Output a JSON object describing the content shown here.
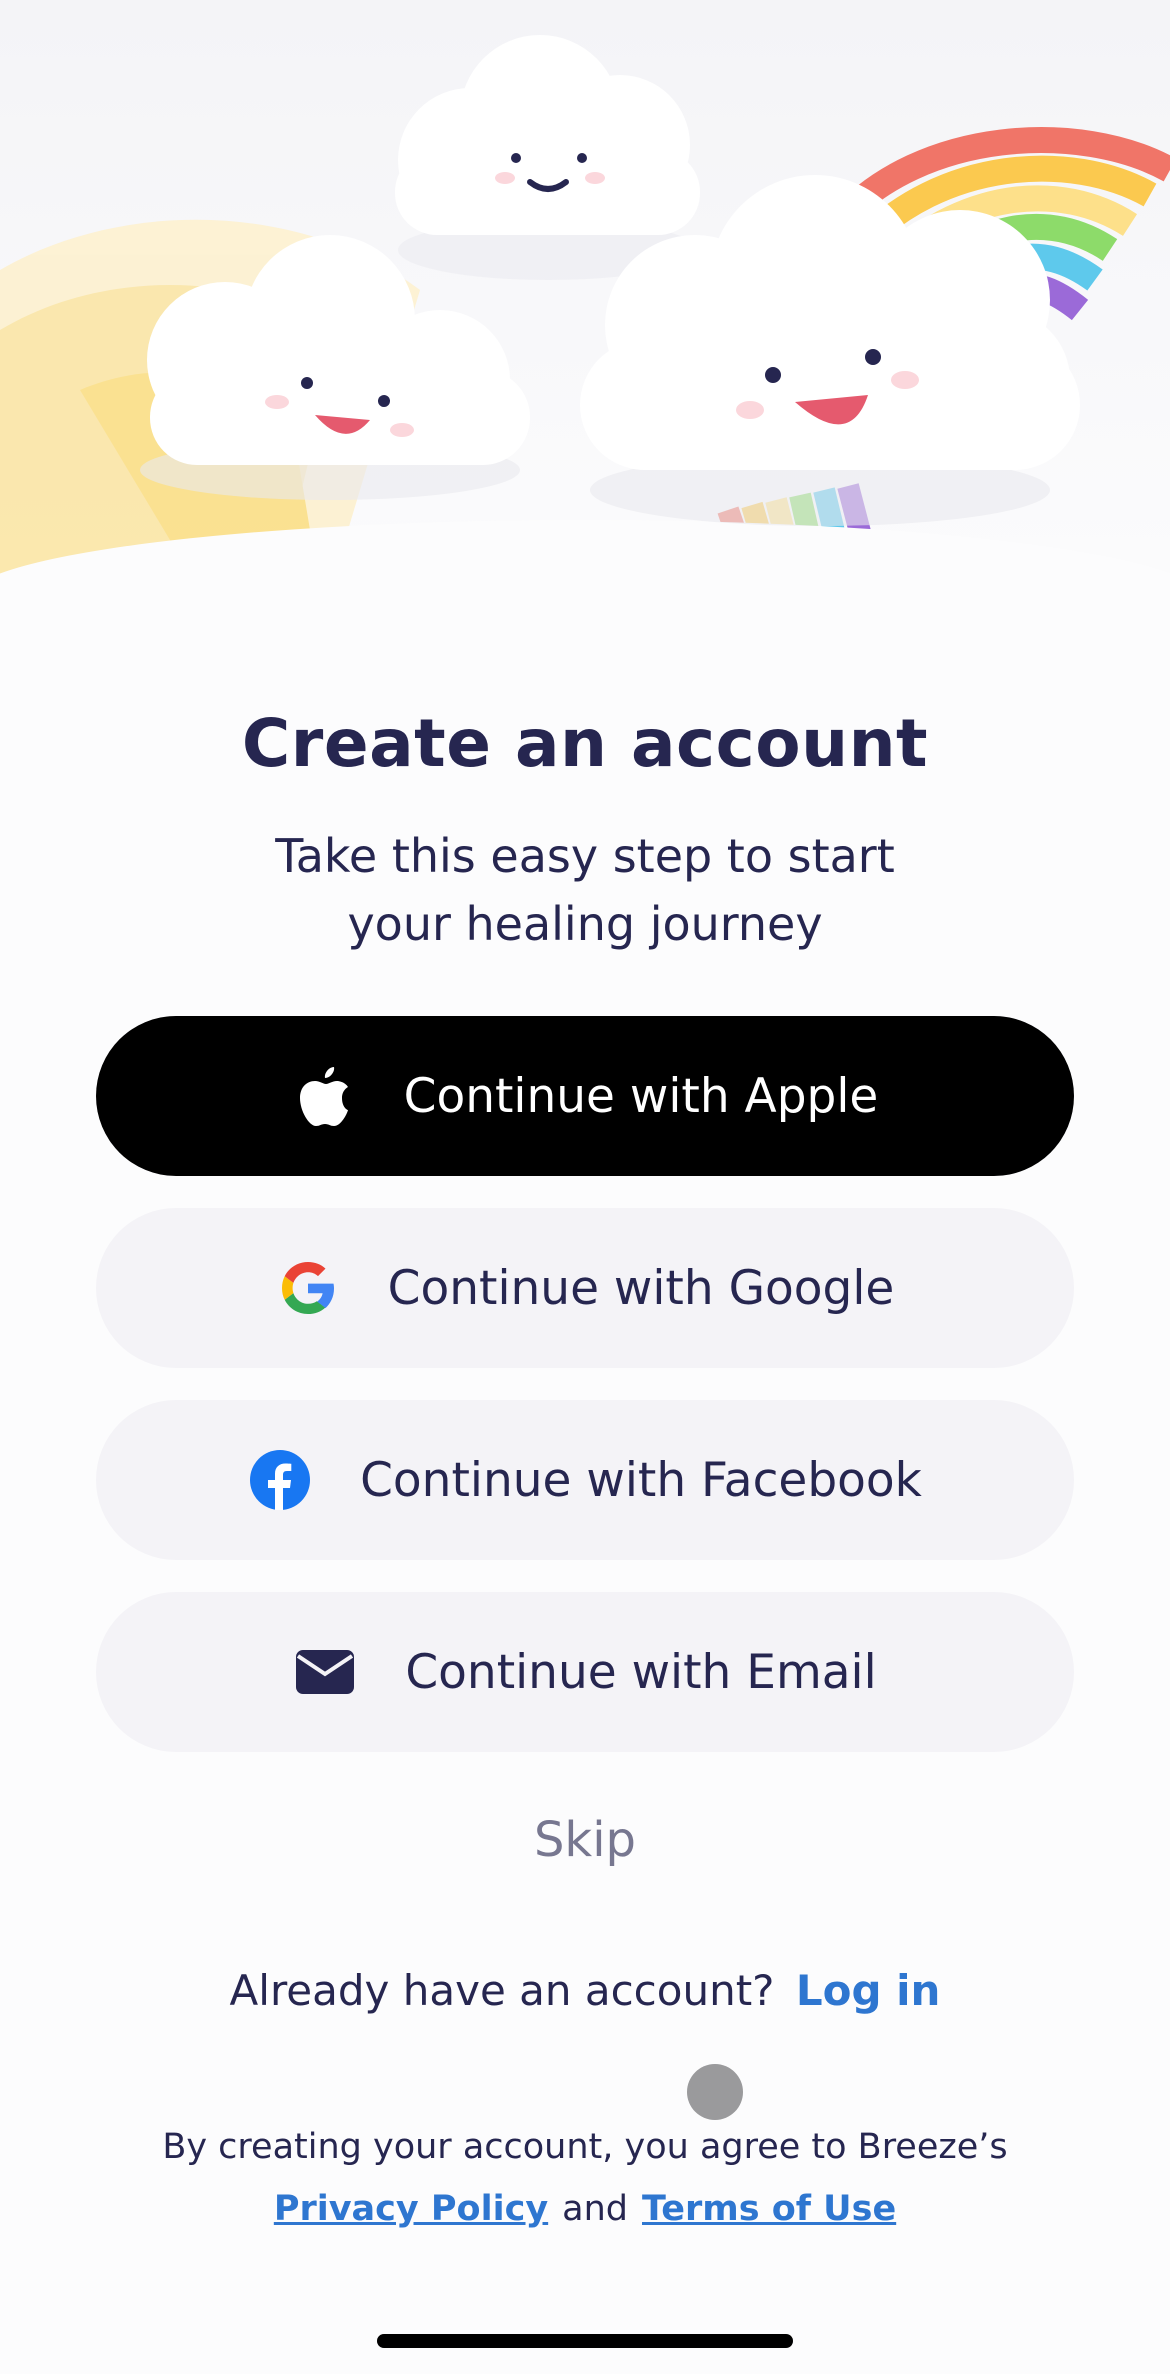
{
  "header": {
    "title": "Create an account",
    "subtitle_line1": "Take this easy step to start",
    "subtitle_line2": "your healing journey"
  },
  "buttons": {
    "apple": {
      "label": "Continue with Apple",
      "icon": "apple-icon",
      "color": "#000000"
    },
    "google": {
      "label": "Continue with Google",
      "icon": "google-icon"
    },
    "facebook": {
      "label": "Continue with Facebook",
      "icon": "facebook-icon",
      "color": "#1877f2"
    },
    "email": {
      "label": "Continue with Email",
      "icon": "envelope-icon"
    }
  },
  "skip_label": "Skip",
  "login": {
    "prompt": "Already have an account?",
    "link": "Log in"
  },
  "legal": {
    "text": "By creating your account, you agree to Breeze’s",
    "privacy": "Privacy Policy",
    "and": "and",
    "terms": "Terms of Use"
  },
  "colors": {
    "accent": "#2e76d0",
    "text": "#262650",
    "button_bg": "#f4f3f7"
  }
}
